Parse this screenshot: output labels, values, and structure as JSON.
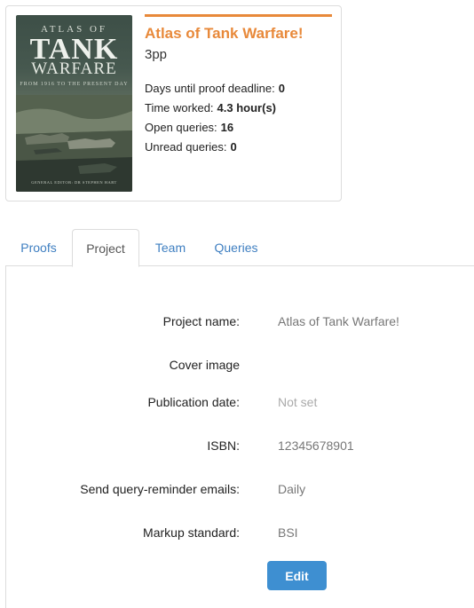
{
  "book": {
    "title": "Atlas of Tank Warfare!",
    "pages": "3pp",
    "cover": {
      "line1": "ATLAS OF",
      "line2": "TANK",
      "line3": "WARFARE",
      "line4": "FROM 1916 TO THE PRESENT DAY",
      "credit": "GENERAL EDITOR: DR STEPHEN HART"
    }
  },
  "stats": [
    {
      "label": "Days until proof deadline:",
      "value": "0"
    },
    {
      "label": "Time worked:",
      "value": "4.3 hour(s)"
    },
    {
      "label": "Open queries:",
      "value": "16"
    },
    {
      "label": "Unread queries:",
      "value": "0"
    }
  ],
  "tabs": [
    {
      "label": "Proofs"
    },
    {
      "label": "Project"
    },
    {
      "label": "Team"
    },
    {
      "label": "Queries"
    }
  ],
  "active_tab": "Project",
  "fields": [
    {
      "label": "Project name:",
      "value": "Atlas of Tank Warfare!"
    },
    {
      "label": "Cover image",
      "value": ""
    },
    {
      "label": "Publication date:",
      "value": "Not set"
    },
    {
      "label": "ISBN:",
      "value": "12345678901"
    },
    {
      "label": "Send query-reminder emails:",
      "value": "Daily"
    },
    {
      "label": "Markup standard:",
      "value": "BSI"
    }
  ],
  "edit_label": "Edit",
  "colors": {
    "accent": "#e8893a",
    "link": "#3f7fc1",
    "button": "#3e8fd1"
  }
}
